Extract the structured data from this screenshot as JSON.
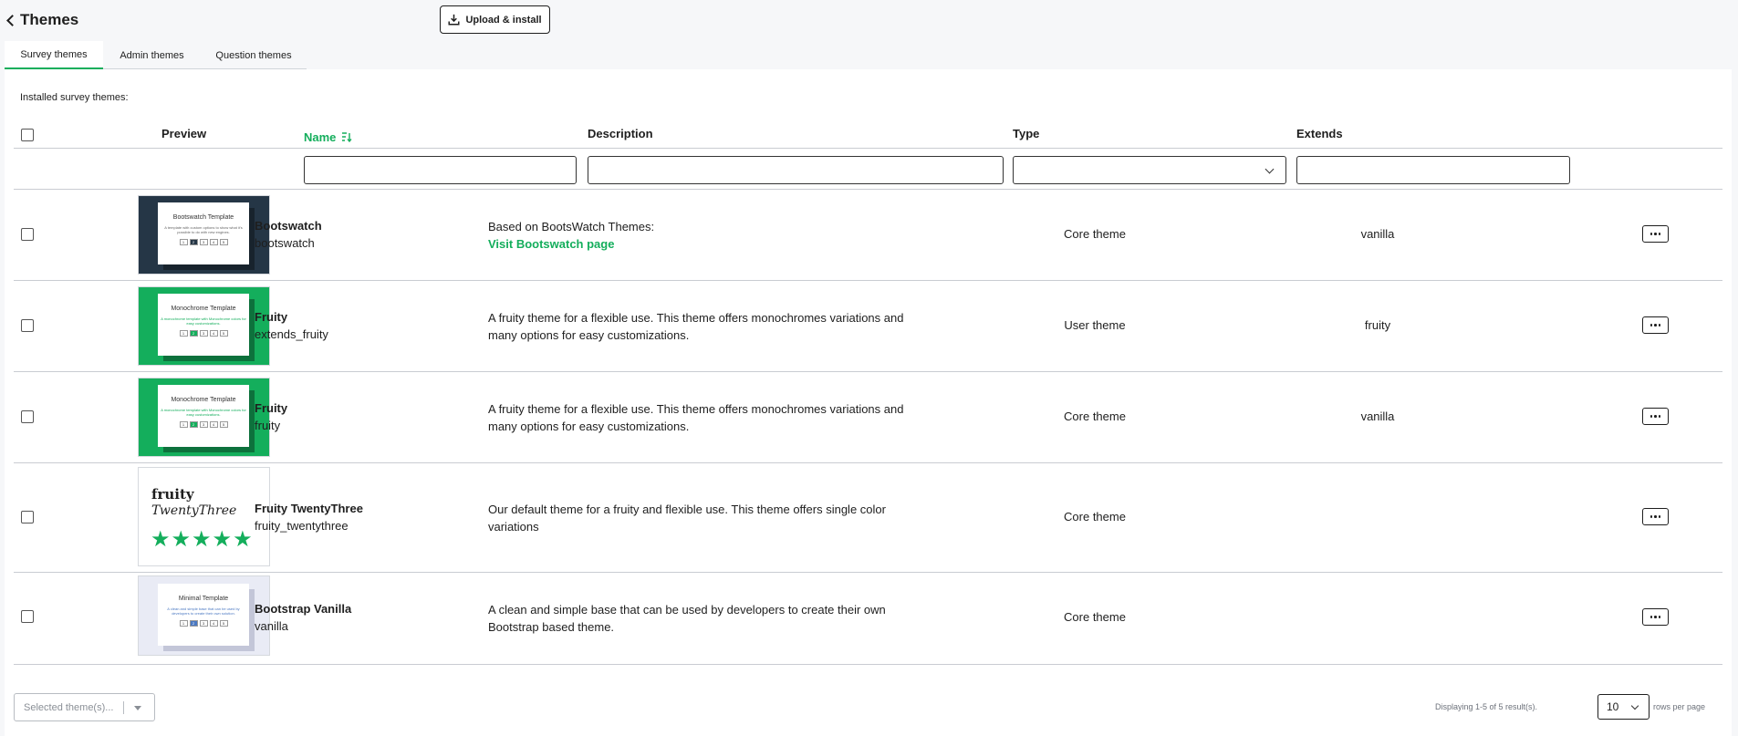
{
  "header": {
    "back_title": "Themes",
    "upload_label": "Upload & install"
  },
  "tabs": [
    {
      "label": "Survey themes"
    },
    {
      "label": "Admin themes"
    },
    {
      "label": "Question themes"
    }
  ],
  "installed_label": "Installed survey themes:",
  "columns": {
    "preview": "Preview",
    "name": "Name",
    "description": "Description",
    "type": "Type",
    "extends": "Extends"
  },
  "themes": [
    {
      "name": "Bootswatch",
      "id": "bootswatch",
      "description": "Based on BootsWatch Themes:",
      "link": "Visit Bootswatch page",
      "type": "Core theme",
      "extends": "vanilla",
      "preview": {
        "title": "Bootswatch Template",
        "sub": "A template with custom options to show what it's possible to do with new engines.",
        "bg": "#253646",
        "nums": [
          "1",
          "2",
          "3",
          "4",
          "5"
        ]
      }
    },
    {
      "name": "Fruity",
      "id": "extends_fruity",
      "description": "A fruity theme for a flexible use. This theme offers monochromes variations and many options for easy customizations.",
      "type": "User theme",
      "extends": "fruity",
      "preview": {
        "title": "Monochrome Template",
        "sub": "A monochrome template with Monochrome colors for easy customizations.",
        "bg": "#14ae5c",
        "nums": [
          "1",
          "2",
          "3",
          "4",
          "5"
        ]
      }
    },
    {
      "name": "Fruity",
      "id": "fruity",
      "description": "A fruity theme for a flexible use. This theme offers monochromes variations and many options for easy customizations.",
      "type": "Core theme",
      "extends": "vanilla",
      "preview": {
        "title": "Monochrome Template",
        "sub": "A monochrome template with Monochrome colors for easy customizations.",
        "bg": "#14ae5c",
        "nums": [
          "1",
          "2",
          "3",
          "4",
          "5"
        ]
      }
    },
    {
      "name": "Fruity TwentyThree",
      "id": "fruity_twentythree",
      "description": "Our default theme for a fruity and flexible use. This theme offers single color variations",
      "type": "Core theme",
      "extends": "",
      "preview": {
        "line1": "fruity",
        "line2": "TwentyThree",
        "stars": "★★★★★"
      }
    },
    {
      "name": "Bootstrap Vanilla",
      "id": "vanilla",
      "description": "A clean and simple base that can be used by developers to create their own Bootstrap based theme.",
      "type": "Core theme",
      "extends": "",
      "preview": {
        "title": "Minimal Template",
        "sub": "A clean and simple base that can be used by developers to create their own solution.",
        "bg": "#e9ebf5",
        "nums": [
          "1",
          "2",
          "3",
          "4",
          "5"
        ]
      }
    }
  ],
  "footer": {
    "selected_placeholder": "Selected theme(s)...",
    "pagination_text": "Displaying 1-5 of 5 result(s).",
    "rows_per_page_value": "10",
    "rows_per_page_label": "rows per page"
  },
  "colors": {
    "accent": "#14ae5c",
    "text": "#1e1e1e"
  }
}
